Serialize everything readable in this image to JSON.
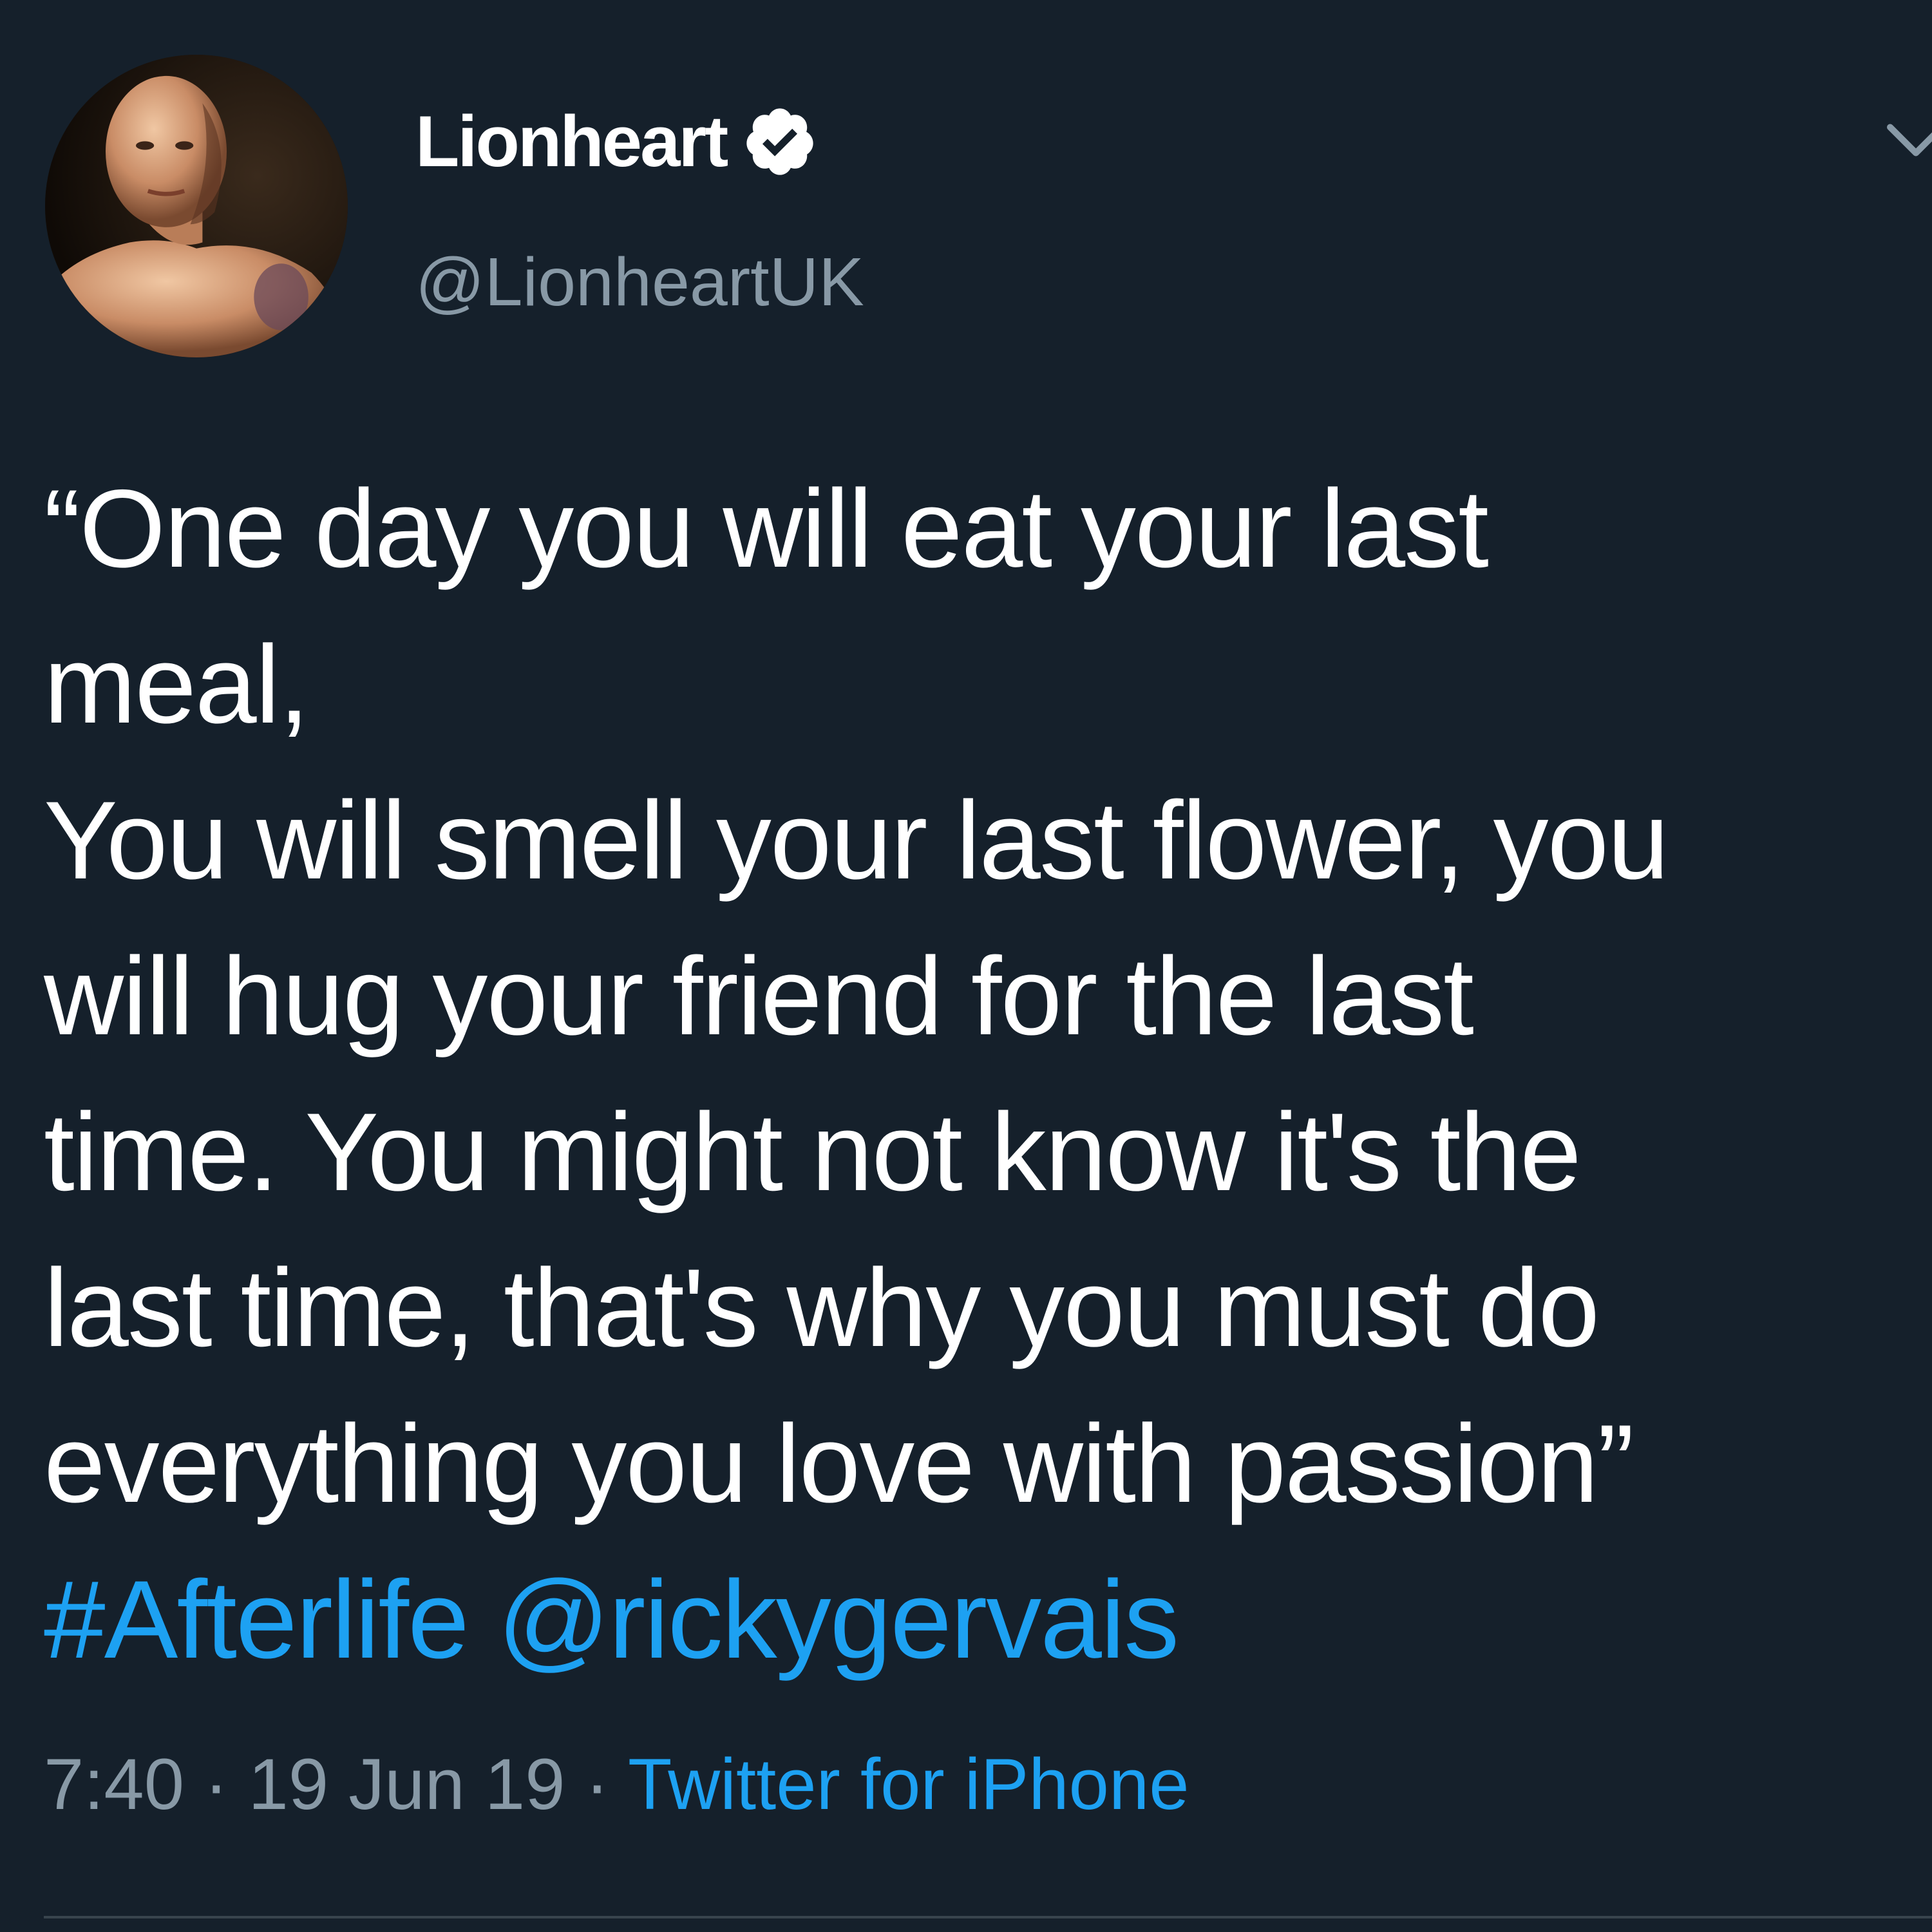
{
  "tweet": {
    "display_name": "Lionheart",
    "verified": true,
    "handle": "@LionheartUK",
    "body_lines": [
      "“One day you will eat your last",
      "meal,",
      "You will smell your last flower, you",
      "will hug your friend for the last",
      "time. You might not know it's the",
      "last time, that's why you must do",
      "everything you love with passion”"
    ],
    "hashtag": "#Afterlife",
    "mention": "@rickygervais",
    "time": "7:40",
    "date": "19 Jun 19",
    "separator": "·",
    "source": "Twitter for iPhone"
  },
  "colors": {
    "background": "#15202b",
    "text_primary": "#ffffff",
    "text_secondary": "#8899a6",
    "accent": "#1da1f2"
  },
  "icons": {
    "verified": "verified-badge-icon",
    "more": "chevron-down-icon"
  }
}
